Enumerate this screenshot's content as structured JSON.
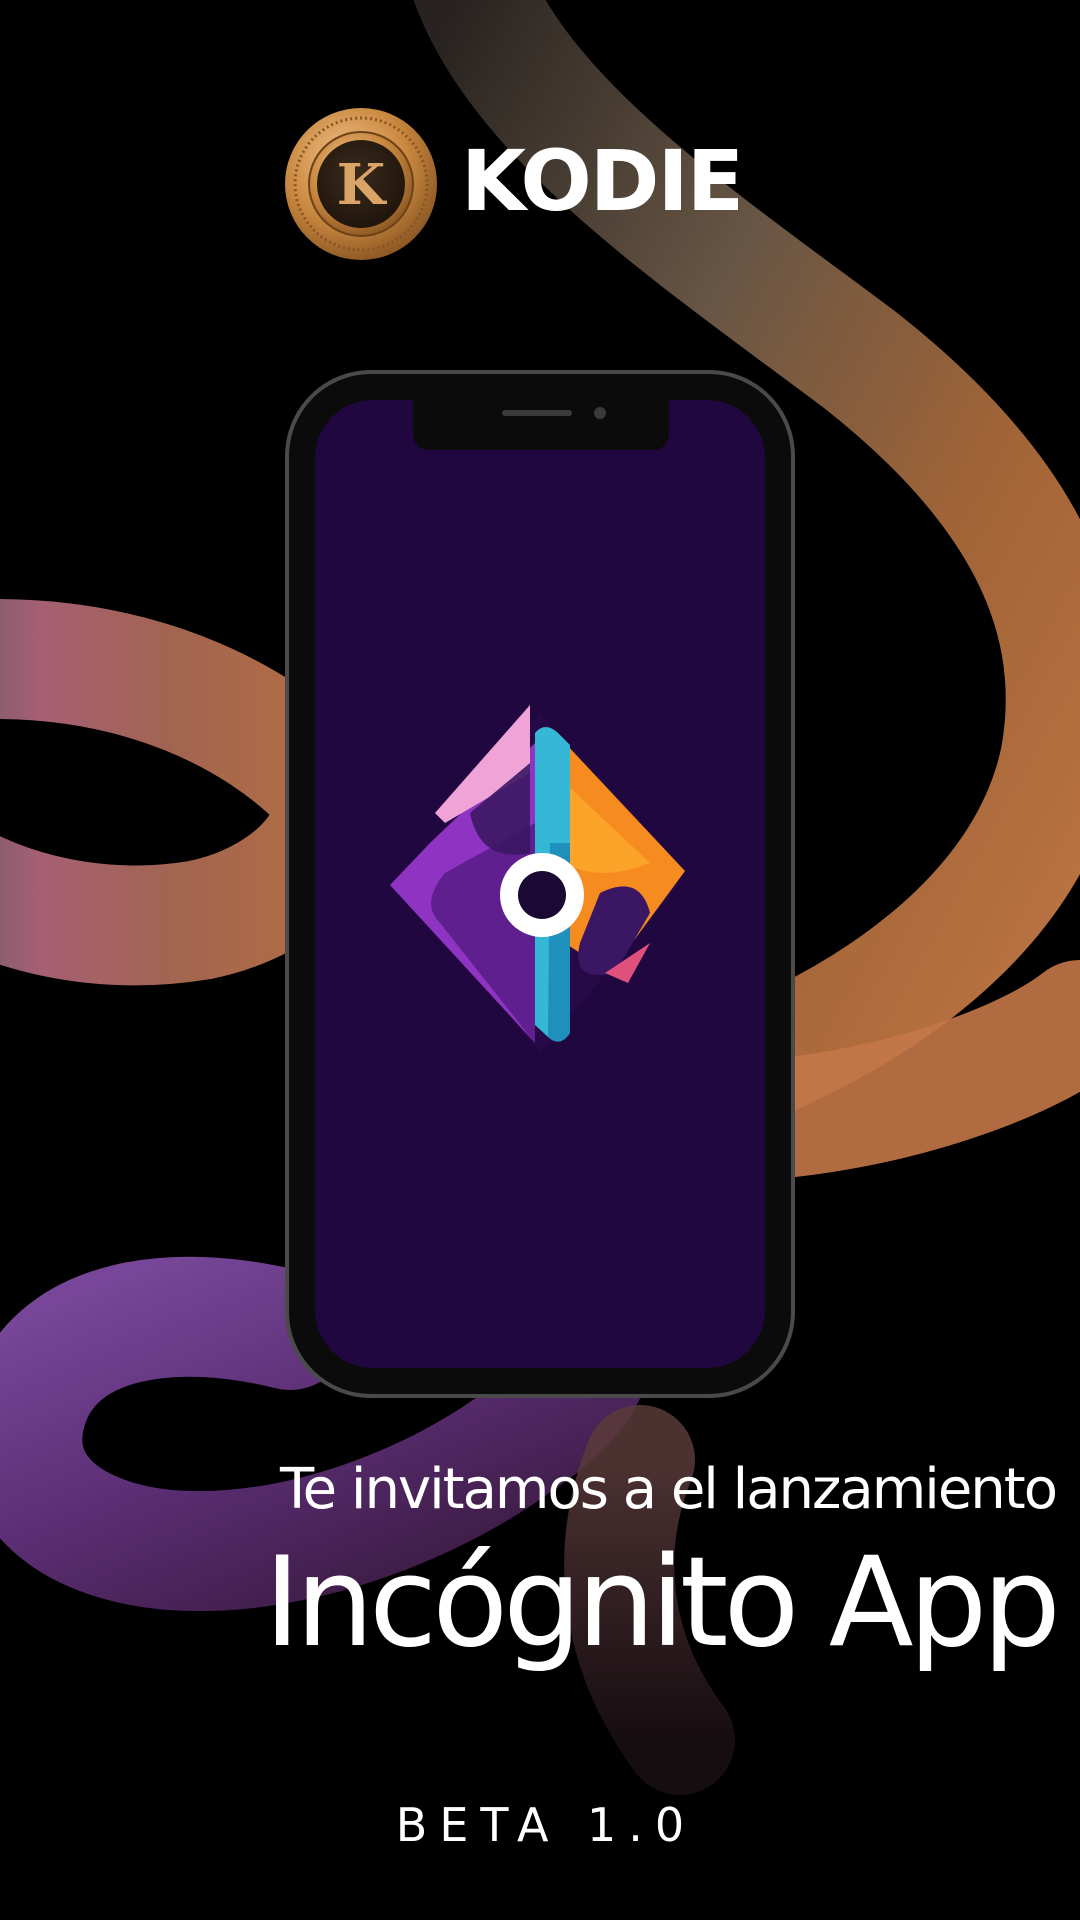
{
  "brand": {
    "name": "KODIE",
    "coin_letter": "K"
  },
  "headline": {
    "invite": "Te invitamos a el lanzamiento",
    "app_name": "Incógnito App"
  },
  "footer": {
    "version": "BETA 1.0"
  },
  "colors": {
    "background": "#000000",
    "phone_screen": "#21073F",
    "phone_frame": "#4A4A4A",
    "coin_gold": "#C8873E",
    "ribbon_orange": "#C9773E",
    "ribbon_pink": "#C06A8A",
    "ribbon_purple": "#6B3A86",
    "logo_pink": "#EFA3D6",
    "logo_cyan": "#34B8D6",
    "logo_orange": "#F68B1F",
    "logo_purple": "#9A3FC9"
  },
  "icons": {
    "coin": "gold-k-coin-icon",
    "app_logo": "incognito-diamond-logo-icon"
  }
}
